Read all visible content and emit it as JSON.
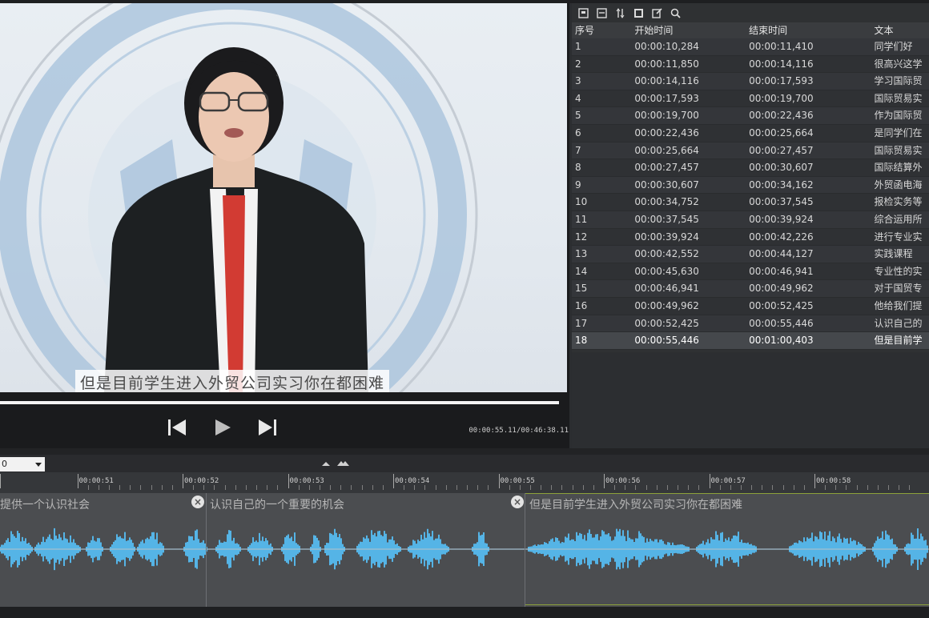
{
  "player": {
    "subtitle_overlay": "但是目前学生进入外贸公司实习你在都困难",
    "timecode": "00:00:55.11/00:46:38.11",
    "progress_fraction": 0.02,
    "controls": [
      "previous",
      "play",
      "next"
    ]
  },
  "toolbar_icons": [
    "import-icon",
    "export-icon",
    "merge-icon",
    "grid-icon",
    "edit-icon",
    "search-icon"
  ],
  "subtitle_list": {
    "columns": {
      "index": "序号",
      "start": "开始时间",
      "end": "结束时间",
      "text": "文本"
    },
    "rows": [
      {
        "index": "1",
        "start": "00:00:10,284",
        "end": "00:00:11,410",
        "text": "同学们好"
      },
      {
        "index": "2",
        "start": "00:00:11,850",
        "end": "00:00:14,116",
        "text": "很高兴这学"
      },
      {
        "index": "3",
        "start": "00:00:14,116",
        "end": "00:00:17,593",
        "text": "学习国际贸"
      },
      {
        "index": "4",
        "start": "00:00:17,593",
        "end": "00:00:19,700",
        "text": "国际贸易实"
      },
      {
        "index": "5",
        "start": "00:00:19,700",
        "end": "00:00:22,436",
        "text": "作为国际贸"
      },
      {
        "index": "6",
        "start": "00:00:22,436",
        "end": "00:00:25,664",
        "text": "是同学们在"
      },
      {
        "index": "7",
        "start": "00:00:25,664",
        "end": "00:00:27,457",
        "text": "国际贸易实"
      },
      {
        "index": "8",
        "start": "00:00:27,457",
        "end": "00:00:30,607",
        "text": "国际结算外"
      },
      {
        "index": "9",
        "start": "00:00:30,607",
        "end": "00:00:34,162",
        "text": "外贸函电海"
      },
      {
        "index": "10",
        "start": "00:00:34,752",
        "end": "00:00:37,545",
        "text": "报检实务等"
      },
      {
        "index": "11",
        "start": "00:00:37,545",
        "end": "00:00:39,924",
        "text": "综合运用所"
      },
      {
        "index": "12",
        "start": "00:00:39,924",
        "end": "00:00:42,226",
        "text": "进行专业实"
      },
      {
        "index": "13",
        "start": "00:00:42,552",
        "end": "00:00:44,127",
        "text": "实践课程"
      },
      {
        "index": "14",
        "start": "00:00:45,630",
        "end": "00:00:46,941",
        "text": "专业性的实"
      },
      {
        "index": "15",
        "start": "00:00:46,941",
        "end": "00:00:49,962",
        "text": "对于国贸专"
      },
      {
        "index": "16",
        "start": "00:00:49,962",
        "end": "00:00:52,425",
        "text": "他给我们提"
      },
      {
        "index": "17",
        "start": "00:00:52,425",
        "end": "00:00:55,446",
        "text": "认识自己的"
      },
      {
        "index": "18",
        "start": "00:00:55,446",
        "end": "00:01:00,403",
        "text": "但是目前学"
      }
    ],
    "selected_index": 17
  },
  "timeline": {
    "zoom_value": "0",
    "ruler_labels": [
      "00:00:51",
      "00:00:52",
      "00:00:53",
      "00:00:54",
      "00:00:55",
      "00:00:56",
      "00:00:57",
      "00:00:58"
    ],
    "segments": [
      {
        "label": "提供一个认识社会"
      },
      {
        "label": "认识自己的一个重要的机会"
      },
      {
        "label": "但是目前学生进入外贸公司实习你在都困难"
      }
    ],
    "waveform_color": "#55b4e6",
    "active_border_color": "#8da23a"
  }
}
